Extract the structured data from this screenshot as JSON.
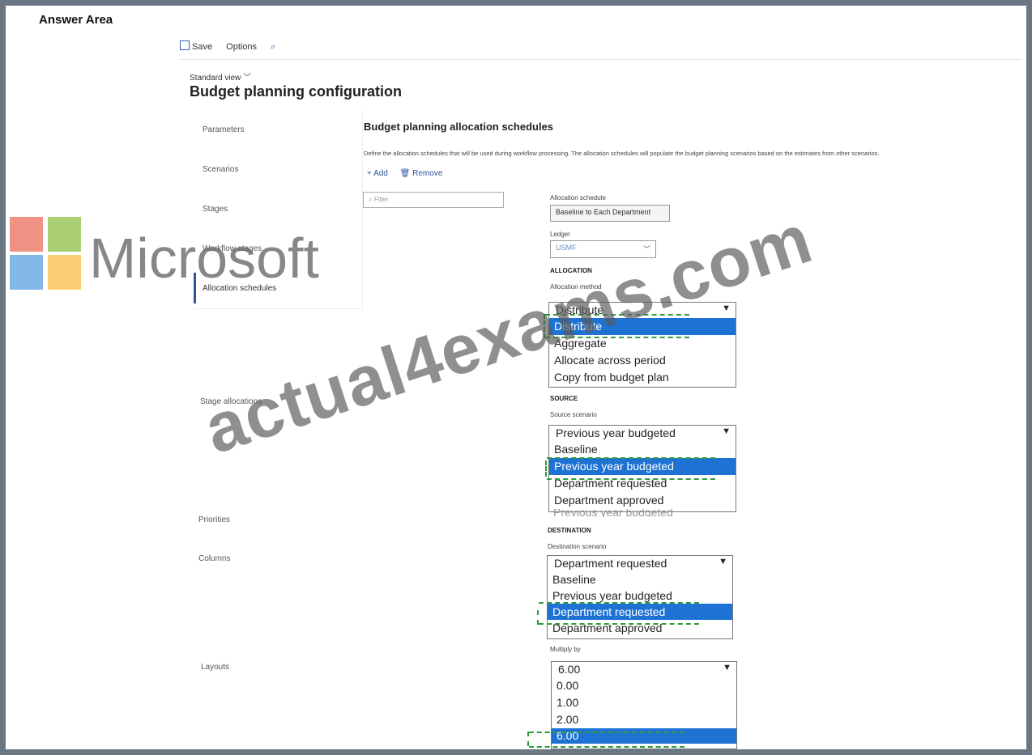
{
  "answer_area": "Answer Area",
  "toolbar": {
    "save": "Save",
    "options": "Options",
    "icons": [
      "save-icon",
      "search-icon"
    ]
  },
  "view_label": "Standard view",
  "page_title": "Budget planning configuration",
  "nav": {
    "parameters": "Parameters",
    "scenarios": "Scenarios",
    "stages": "Stages",
    "workflow_stages": "Workflow stages",
    "allocation_schedules": "Allocation schedules",
    "stage_allocations": "Stage allocations",
    "priorities": "Priorities",
    "columns": "Columns",
    "layouts": "Layouts"
  },
  "section": {
    "title": "Budget planning allocation schedules",
    "description": "Define the allocation schedules that will be used during workflow processing. The allocation schedules will populate the budget planning scenarios based on the estimates from other scenarios.",
    "add": "Add",
    "remove": "Remove",
    "filter_placeholder": "Filter"
  },
  "form": {
    "allocation_schedule_label": "Allocation schedule",
    "allocation_schedule_value": "Baseline to Each Department",
    "ledger_label": "Ledger",
    "ledger_value": "USMF",
    "allocation_header": "ALLOCATION",
    "allocation_method_label": "Allocation method",
    "allocation_method": {
      "selected": "Distribute",
      "options": [
        "Distribute",
        "Aggregate",
        "Allocate across period",
        "Copy from budget plan"
      ],
      "highlighted": "Distribute"
    },
    "source_header": "SOURCE",
    "source_scenario_label": "Source scenario",
    "source_scenario": {
      "selected": "Previous year budgeted",
      "options": [
        "Baseline",
        "Previous year budgeted",
        "Department requested",
        "Department approved"
      ],
      "highlighted": "Previous year budgeted",
      "obscured_text": "Previous year budgeted"
    },
    "destination_header": "DESTINATION",
    "destination_scenario_label": "Destination scenario",
    "destination_scenario": {
      "selected": "Department requested",
      "options": [
        "Baseline",
        "Previous year budgeted",
        "Department requested",
        "Department approved"
      ],
      "highlighted": "Department requested"
    },
    "multiply_label": "Multiply by",
    "multiply_by": {
      "selected": "6.00",
      "options": [
        "0.00",
        "1.00",
        "2.00",
        "6.00"
      ],
      "highlighted": "6.00"
    }
  },
  "watermarks": {
    "brand": "Microsoft",
    "site": "actual4exams.com"
  },
  "colors": {
    "selection": "#1e72d4",
    "answer_dash": "#2d9c3c",
    "accent": "#2b579a",
    "border": "#6b7785"
  }
}
